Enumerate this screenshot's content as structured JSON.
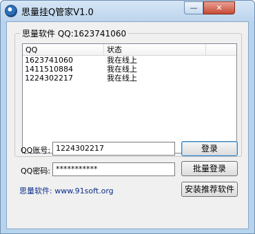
{
  "window": {
    "title": "思量挂Q管家V1.0",
    "minimize_glyph": "—",
    "close_glyph": "✕"
  },
  "group": {
    "legend": "思量软件 QQ:1623741060"
  },
  "list": {
    "columns": [
      "QQ",
      "状态"
    ],
    "rows": [
      {
        "qq": "1623741060",
        "status": "我在线上"
      },
      {
        "qq": "1411510884",
        "status": "我在线上"
      },
      {
        "qq": "1224302217",
        "status": "我在线上"
      }
    ]
  },
  "form": {
    "account_label": "QQ账号:",
    "account_value": "1224302217",
    "password_label": "QQ密码:",
    "password_value": "***********"
  },
  "buttons": {
    "login": "登录",
    "batch_login": "批量登录",
    "install": "安装推荐软件"
  },
  "footer": {
    "text": "思量软件: www.91soft.org"
  },
  "icons": {
    "app": "app-icon",
    "minimize": "minimize-icon",
    "close": "close-icon"
  }
}
